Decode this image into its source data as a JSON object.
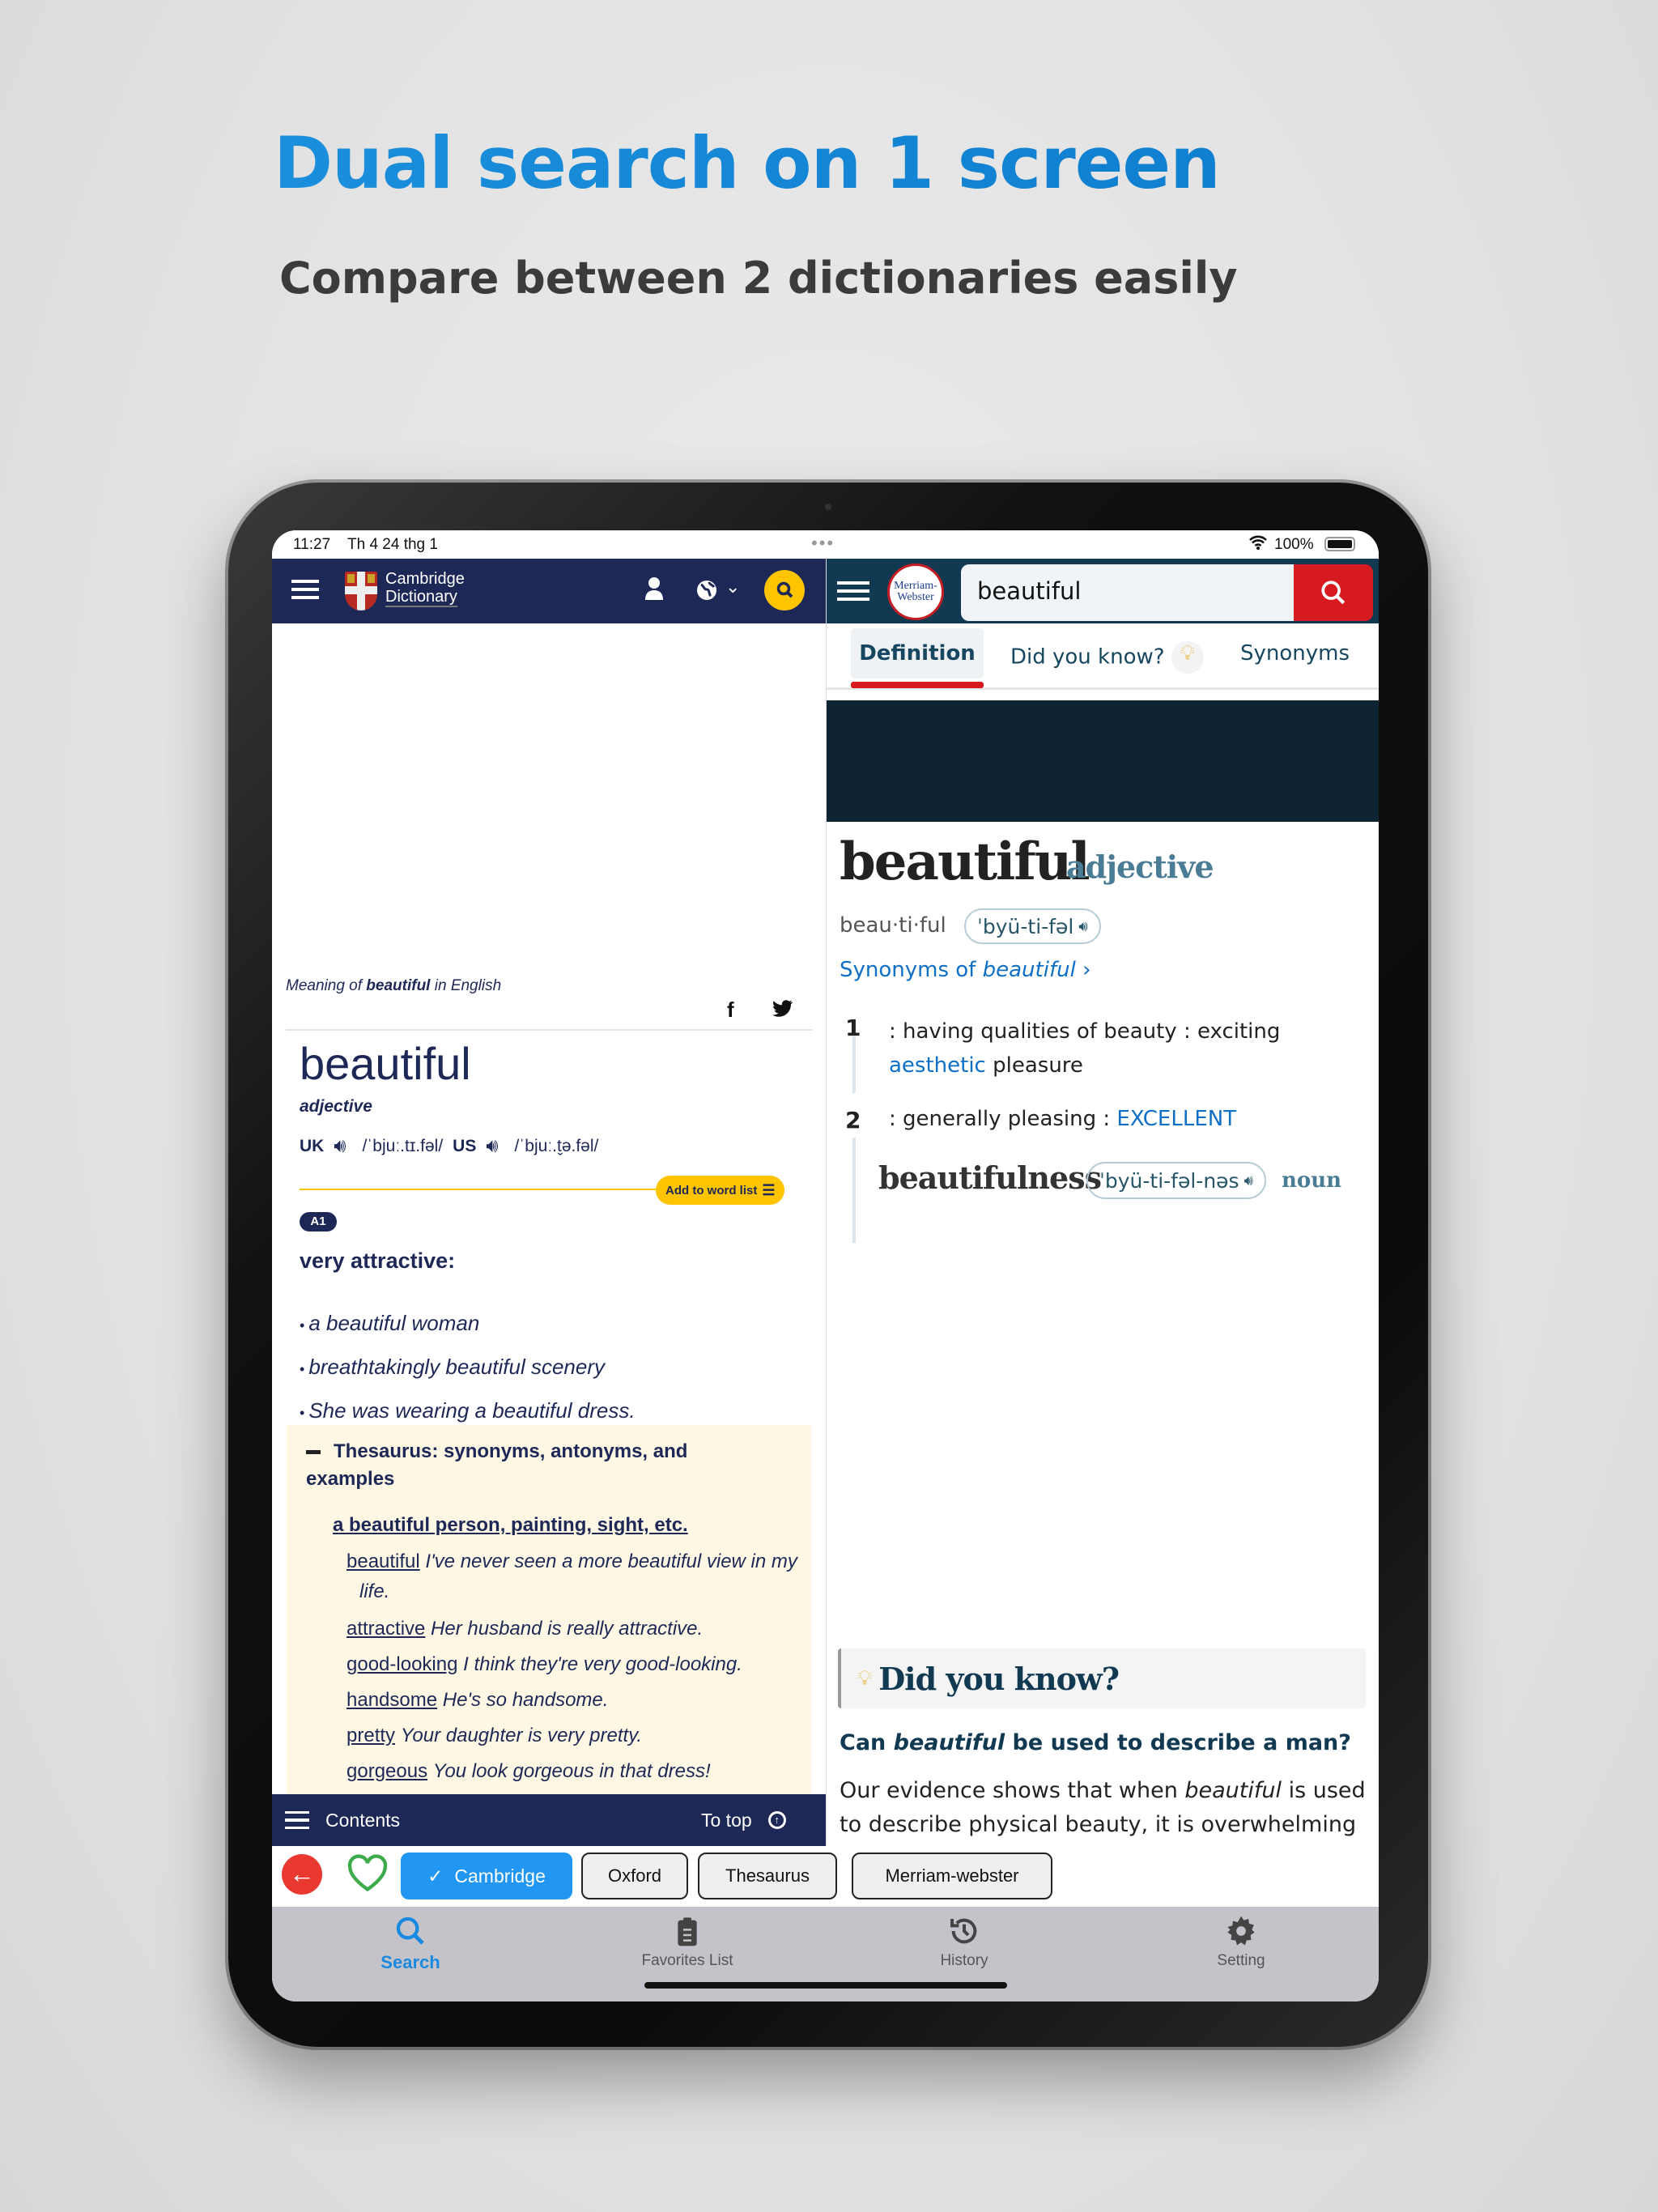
{
  "promo": {
    "headline": "Dual search on 1 screen",
    "subhead": "Compare between 2 dictionaries easily"
  },
  "status": {
    "time": "11:27",
    "date": "Th 4 24 thg 1",
    "battery": "100%"
  },
  "left": {
    "brand_line1": "Cambridge",
    "brand_line2": "Dictionary",
    "meaning_prefix": "Meaning of ",
    "meaning_word": "beautiful",
    "meaning_suffix": " in English",
    "headword": "beautiful",
    "pos": "adjective",
    "uk_label": "UK",
    "uk_ipa": "/ˈbjuː.tɪ.fəl/",
    "us_label": "US",
    "us_ipa": "/ˈbjuː.t̬ə.fəl/",
    "add_to_word_list": "Add to word list",
    "level": "A1",
    "definition": "very attractive:",
    "examples": [
      "a beautiful woman",
      "breathtakingly beautiful scenery",
      "She was wearing a beautiful dress."
    ],
    "thesaurus": {
      "title": "Thesaurus: synonyms, antonyms, and examples",
      "group": "a beautiful person, painting, sight, etc.",
      "entries": [
        {
          "word": "beautiful",
          "example": "I've never seen a more beautiful view in my life."
        },
        {
          "word": "attractive",
          "example": "Her husband is really attractive."
        },
        {
          "word": "good-looking",
          "example": "I think they're very good-looking."
        },
        {
          "word": "handsome",
          "example": "He's so handsome."
        },
        {
          "word": "pretty",
          "example": "Your daughter is very pretty."
        },
        {
          "word": "gorgeous",
          "example": "You look gorgeous in that dress!"
        }
      ]
    },
    "contents": "Contents",
    "to_top": "To top"
  },
  "right": {
    "logo_line1": "Merriam-",
    "logo_line2": "Webster",
    "search_value": "beautiful",
    "tabs": [
      "Definition",
      "Did you know?",
      "Synonyms"
    ],
    "active_tab": "Definition",
    "headword": "beautiful",
    "pos": "adjective",
    "syllables": "beau·ti·ful",
    "pron": "ˈbyü-ti-fəl",
    "synonyms_prefix": "Synonyms of ",
    "synonyms_word": "beautiful",
    "senses": [
      {
        "num": "1",
        "text": ": having qualities of beauty : exciting ",
        "link": "aesthetic",
        "after": " pleasure"
      },
      {
        "num": "2",
        "text": ": generally pleasing : ",
        "link": "EXCELLENT",
        "after": ""
      }
    ],
    "derived": {
      "word": "beautifulness",
      "pron": "ˈbyü-ti-fəl-nəs",
      "pos": "noun"
    },
    "dyk_title": "Did you know?",
    "question_pre": "Can ",
    "question_word": "beautiful",
    "question_post": " be used to describe a man?",
    "para_1a": "Our evidence shows that when ",
    "para_1b": "beautiful",
    "para_1c": " is used",
    "para_2": "to describe physical beauty, it is overwhelming"
  },
  "dict_chips": [
    {
      "label": "Cambridge",
      "selected": true
    },
    {
      "label": "Oxford",
      "selected": false
    },
    {
      "label": "Thesaurus",
      "selected": false
    },
    {
      "label": "Merriam-webster",
      "selected": false
    }
  ],
  "tabbar": [
    {
      "label": "Search",
      "icon": "search-icon",
      "active": true
    },
    {
      "label": "Favorites List",
      "icon": "clipboard-icon"
    },
    {
      "label": "History",
      "icon": "history-icon"
    },
    {
      "label": "Setting",
      "icon": "gear-icon"
    }
  ],
  "colors": {
    "cambridge_navy": "#1d2857",
    "mw_header": "#113a52",
    "mw_red": "#d71920",
    "accent_blue": "#2196f3",
    "link_blue": "#0e6fc7",
    "yellow": "#fec400"
  }
}
